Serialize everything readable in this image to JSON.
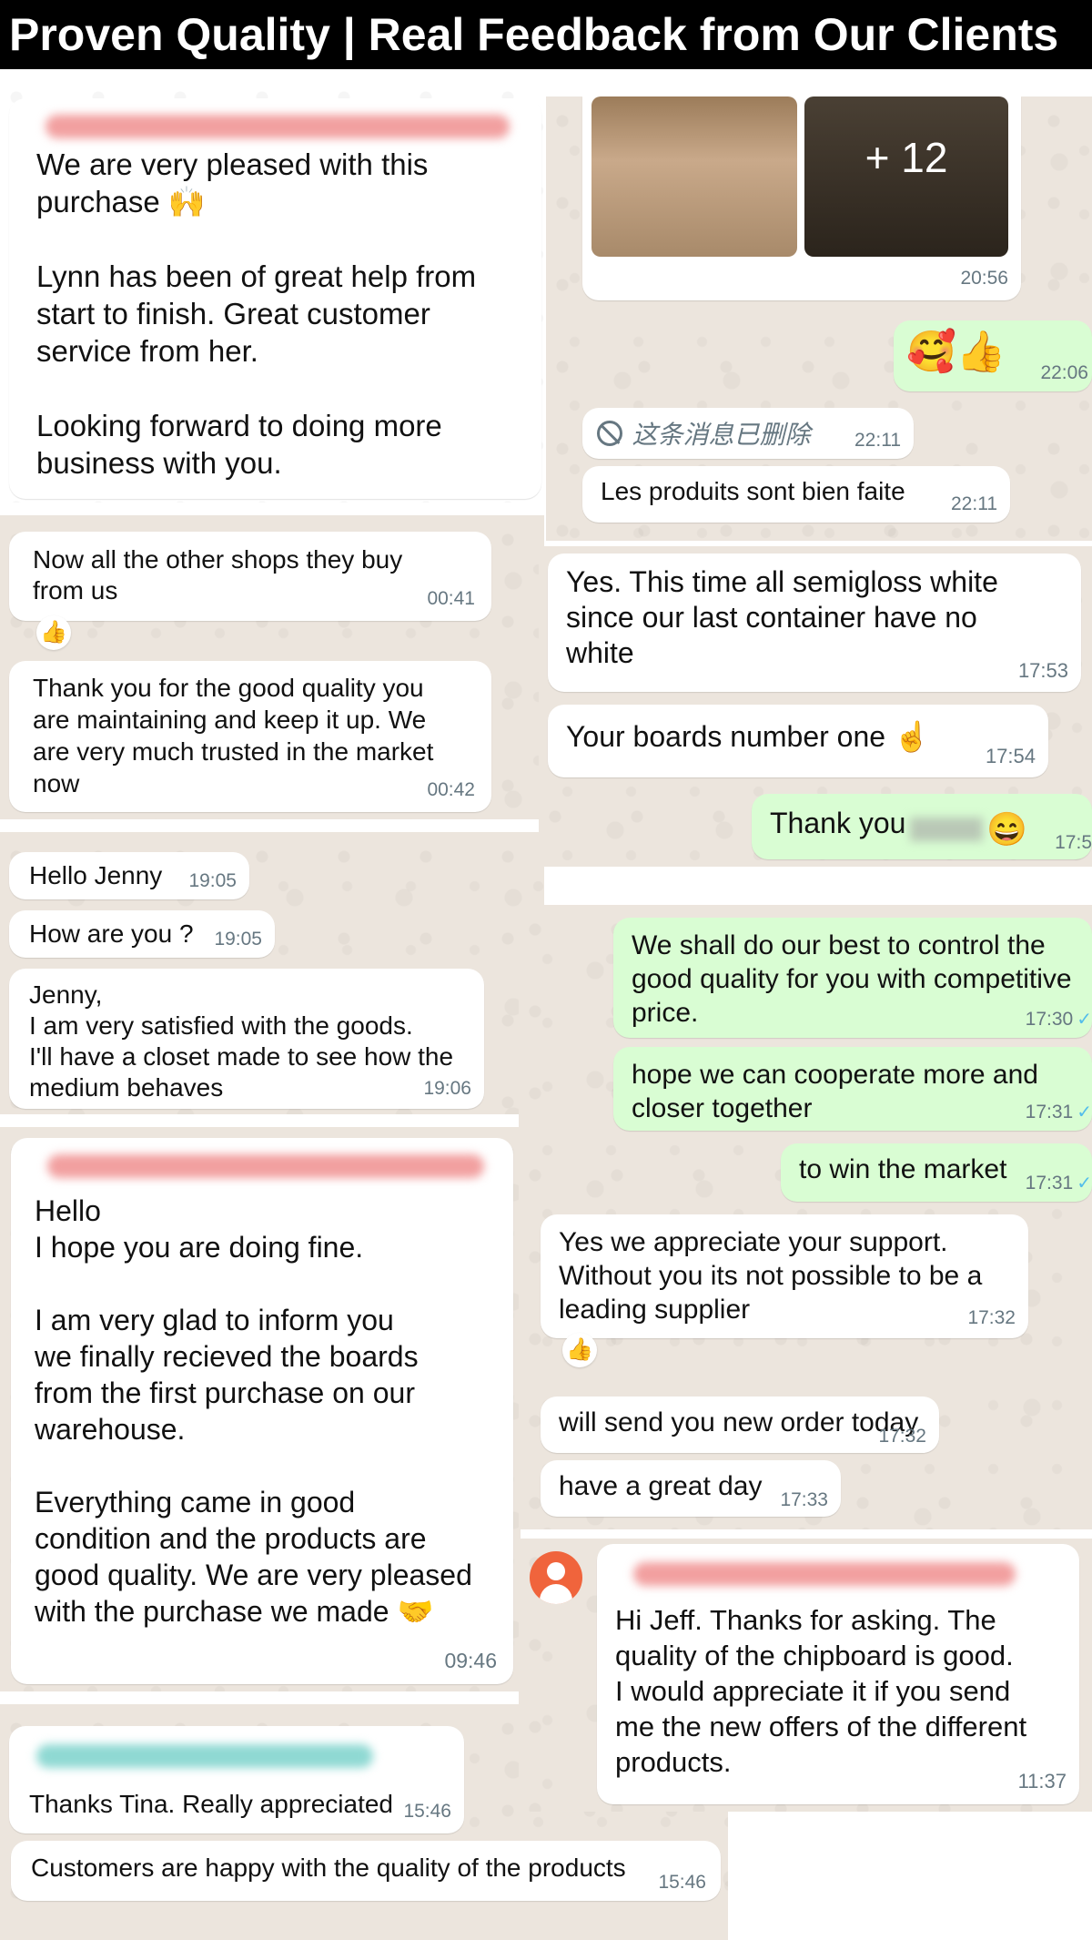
{
  "banner": {
    "title": "Proven Quality | Real Feedback from Our Clients"
  },
  "left": {
    "c1": {
      "text": "We are very pleased with this\npurchase 🙌\n\nLynn has been of great help from\nstart to finish. Great customer\nservice from her.\n\nLooking forward to doing more\nbusiness with you."
    },
    "c2": {
      "m1": {
        "text": "Now all the other shops they buy\nfrom us",
        "time": "00:41",
        "reaction": "👍"
      },
      "m2": {
        "text": "Thank you for the good quality you\nare maintaining and keep it up. We\nare very much trusted in the market\nnow",
        "time": "00:42"
      }
    },
    "c3": {
      "m1": {
        "text": "Hello Jenny",
        "time": "19:05"
      },
      "m2": {
        "text": "How are you ?",
        "time": "19:05"
      },
      "m3": {
        "text": "Jenny,\nI am very satisfied with the goods.\nI'll have a closet made to see how the\nmedium behaves",
        "time": "19:06"
      }
    },
    "c4": {
      "text": "Hello\nI hope you are doing fine.\n\nI am very glad to inform you\nwe finally recieved the boards\nfrom the first purchase on our\nwarehouse.\n\nEverything came in good\ncondition and the products are\ngood quality. We are very pleased\nwith the purchase we made 🤝",
      "time": "09:46"
    },
    "c5": {
      "m1": {
        "text": "Thanks Tina. Really appreciated",
        "time": "15:46"
      },
      "m2": {
        "text": "Customers are happy with the quality of the products",
        "time": "15:46"
      }
    }
  },
  "right": {
    "r1": {
      "photo_more": "+ 12",
      "photo_time": "20:56",
      "emoji_msg": "🥰👍",
      "emoji_time": "22:06",
      "deleted_text": "这条消息已删除",
      "deleted_time": "22:11",
      "m1": {
        "text": "Les produits sont bien faite",
        "time": "22:11"
      }
    },
    "r2": {
      "m1": {
        "text": "Yes. This time all semigloss white\nsince our last container have no\nwhite",
        "time": "17:53"
      },
      "m2": {
        "text": "Your boards number one ☝️",
        "time": "17:54"
      },
      "m3": {
        "text": "Thank you",
        "emoji": "😄",
        "time": "17:5"
      }
    },
    "r3": {
      "m1": {
        "text": "We shall do our best to control the\ngood quality for you with competitive\nprice.",
        "time": "17:30"
      },
      "m2": {
        "text": "hope we can cooperate more and\ncloser together",
        "time": "17:31"
      },
      "m3": {
        "text": "to win the market",
        "time": "17:31"
      },
      "m4": {
        "text": "Yes we appreciate your support.\nWithout you its not possible to be a\nleading supplier",
        "time": "17:32",
        "reaction": "👍"
      },
      "m5": {
        "text": "will send you new order today",
        "time": "17:32"
      },
      "m6": {
        "text": "have a great day",
        "time": "17:33"
      }
    },
    "r4": {
      "text": "Hi Jeff. Thanks for asking. The\nquality of the chipboard is good.\nI would appreciate it if you send\nme the new offers of the different\nproducts.",
      "time": "11:37"
    }
  },
  "colors": {
    "chat_bg": "#ece5dd",
    "incoming": "#ffffff",
    "outgoing": "#d9fdd3",
    "read_check": "#53bdeb",
    "avatar": "#f0643c"
  },
  "icons": [
    "prohibited-icon",
    "double-check-icon",
    "avatar-icon"
  ]
}
